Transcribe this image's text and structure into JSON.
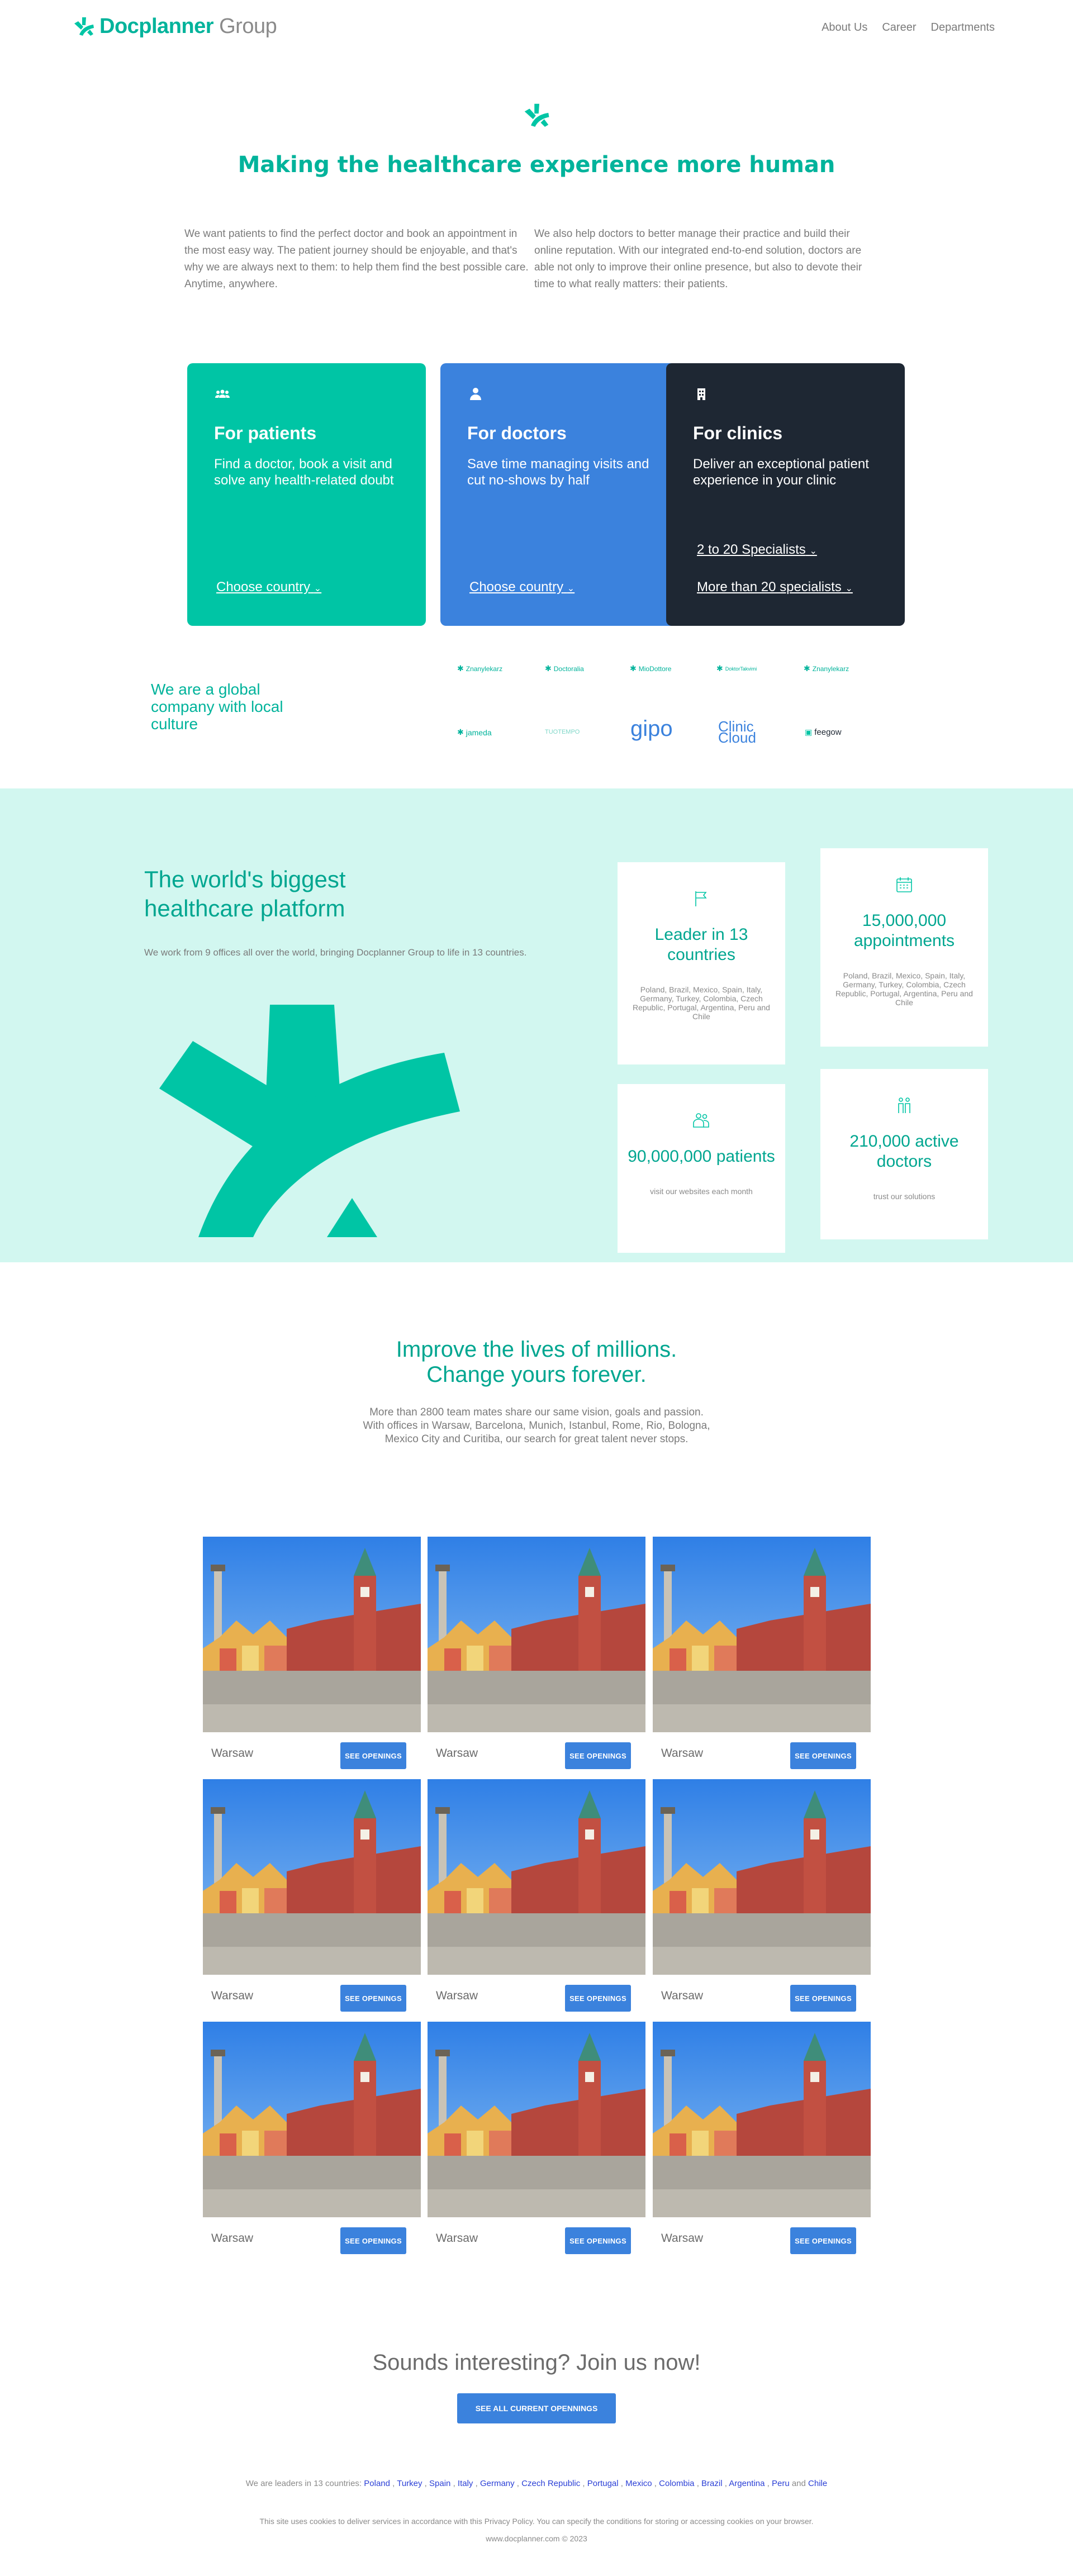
{
  "header": {
    "brand": "Docplanner",
    "brand_suffix": " Group",
    "nav": [
      "About Us",
      "Career",
      "Departments"
    ]
  },
  "hero": {
    "title": "Making the healthcare experience more human",
    "left_text": "We want patients to find the perfect doctor and book an appointment in the most easy way. The patient journey should be enjoyable, and that's why we are always next to them: to help them find the best possible care. Anytime, anywhere.",
    "right_text": "We also help doctors to better manage their practice and build their online reputation. With our integrated end-to-end solution, doctors are able not only to improve their online presence, but also to devote their time to what really matters: their patients."
  },
  "cards": [
    {
      "title": "For patients",
      "text": "Find a doctor, book a visit and solve any health-related doubt",
      "links": [
        "Choose country"
      ]
    },
    {
      "title": "For doctors",
      "text": "Save time managing visits and cut no-shows by half",
      "links": [
        "Choose country"
      ]
    },
    {
      "title": "For clinics",
      "text": "Deliver an exceptional patient experience in your clinic",
      "links": [
        "2 to 20 Specialists",
        "More than 20 specialists"
      ]
    }
  ],
  "partners": {
    "heading": "We are a global company with local culture",
    "row1": [
      "Znanylekarz",
      "Doctoralia",
      "MioDottore",
      "DoktorTakvimi",
      "Znanylekarz"
    ],
    "row2": [
      "jameda",
      "TUOTEMPO",
      "gipo",
      "Clinic Cloud",
      "feegow"
    ]
  },
  "platform": {
    "title": "The world's biggest healthcare platform",
    "subtitle": "We work from 9 offices all over the world, bringing Docplanner Group to life in 13 countries.",
    "stats": [
      {
        "value": "Leader in 13 countries",
        "desc": "Poland, Brazil, Mexico, Spain, Italy, Germany, Turkey, Colombia, Czech Republic, Portugal, Argentina, Peru and Chile",
        "icon": "flag-icon"
      },
      {
        "value": "15,000,000 appointments",
        "desc": "Poland, Brazil, Mexico, Spain, Italy, Germany, Turkey, Colombia, Czech Republic, Portugal, Argentina, Peru and Chile",
        "icon": "calendar-icon"
      },
      {
        "value": "90,000,000 patients",
        "desc": "visit our websites each month",
        "icon": "people-icon"
      },
      {
        "value": "210,000 active doctors",
        "desc": "trust our solutions",
        "icon": "doctors-icon"
      }
    ]
  },
  "improve": {
    "title_line1": "Improve the lives of millions.",
    "title_line2": "Change yours forever.",
    "sub_line1": "More than 2800 team mates share our same vision, goals and passion.",
    "sub_line2": "With offices in Warsaw, Barcelona, Munich, Istanbul, Rome, Rio, Bologna,",
    "sub_line3": "Mexico City and Curitiba, our search for great talent never stops."
  },
  "offices": {
    "city": "Warsaw",
    "button": "SEE OPENINGS"
  },
  "join": {
    "title": "Sounds interesting? Join us now!",
    "button": "SEE ALL CURRENT OPENNINGS"
  },
  "footer": {
    "leaders_prefix": "We are leaders in 13 countries:",
    "countries": [
      "Poland",
      "Turkey",
      "Spain",
      "Italy",
      "Germany",
      "Czech Republic",
      "Portugal",
      "Mexico",
      "Colombia",
      "Brazil",
      "Argentina",
      "Peru",
      "Chile"
    ],
    "cookies": "This site uses cookies to deliver services in accordance with this Privacy Policy. You can specify the conditions for storing or accessing cookies on your browser.",
    "copyright": "www.docplanner.com © 2023"
  },
  "colors": {
    "green": "#00c5a5",
    "blue": "#3b82dd",
    "navy": "#1e2733",
    "mint": "#d2f7f0"
  }
}
